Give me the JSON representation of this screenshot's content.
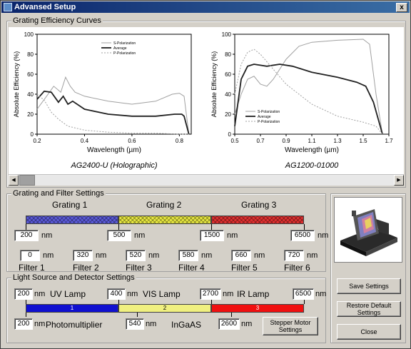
{
  "window": {
    "title": "Advansed Setup",
    "close_label": "x"
  },
  "curves": {
    "group_title": "Grating Efficiency Curves",
    "chart_data": [
      {
        "type": "line",
        "title": "",
        "caption": "AG2400-U  (Holographic)",
        "xlabel": "Wavelength (µm)",
        "ylabel": "Absolute Efficiency (%)",
        "xlim": [
          0.2,
          0.85
        ],
        "ylim": [
          0,
          100
        ],
        "xticks": [
          "0.2",
          "0.4",
          "0.6",
          "0.8"
        ],
        "yticks": [
          "0",
          "20",
          "40",
          "60",
          "80",
          "100"
        ],
        "legend": [
          "S-Polarization",
          "Average",
          "P-Polarization"
        ],
        "series": [
          {
            "name": "S-Polarization",
            "color": "#a0a0a0",
            "x": [
              0.2,
              0.24,
              0.27,
              0.3,
              0.32,
              0.34,
              0.36,
              0.4,
              0.5,
              0.6,
              0.7,
              0.77,
              0.8,
              0.82,
              0.84
            ],
            "y": [
              25,
              38,
              48,
              42,
              57,
              48,
              42,
              38,
              33,
              30,
              33,
              40,
              41,
              38,
              0
            ]
          },
          {
            "name": "Average",
            "color": "#202020",
            "x": [
              0.2,
              0.23,
              0.26,
              0.29,
              0.31,
              0.33,
              0.35,
              0.4,
              0.5,
              0.6,
              0.7,
              0.78,
              0.81,
              0.82,
              0.84
            ],
            "y": [
              35,
              43,
              42,
              32,
              38,
              30,
              33,
              25,
              20,
              18,
              18,
              20,
              20,
              18,
              0
            ]
          },
          {
            "name": "P-Polarization",
            "color": "#a0a0a0",
            "x": [
              0.2,
              0.23,
              0.26,
              0.29,
              0.33,
              0.4,
              0.5,
              0.6,
              0.7,
              0.8,
              0.84
            ],
            "y": [
              40,
              34,
              22,
              15,
              8,
              4,
              2,
              1,
              1,
              0,
              0
            ]
          }
        ]
      },
      {
        "type": "line",
        "title": "",
        "caption": "AG1200-01000",
        "xlabel": "Wavelength (µm)",
        "ylabel": "Absolute Efficiency (%)",
        "xlim": [
          0.5,
          1.7
        ],
        "ylim": [
          0,
          100
        ],
        "xticks": [
          "0.5",
          "0.7",
          "0.9",
          "1.1",
          "1.3",
          "1.5",
          "1.7"
        ],
        "yticks": [
          "0",
          "20",
          "40",
          "60",
          "80",
          "100"
        ],
        "legend": [
          "S-Polarization",
          "Average",
          "P-Polarization"
        ],
        "series": [
          {
            "name": "S-Polarization",
            "color": "#a0a0a0",
            "x": [
              0.5,
              0.55,
              0.6,
              0.65,
              0.7,
              0.75,
              0.8,
              0.9,
              1.0,
              1.1,
              1.3,
              1.5,
              1.55,
              1.6,
              1.65
            ],
            "y": [
              20,
              40,
              55,
              58,
              50,
              48,
              55,
              75,
              88,
              92,
              94,
              95,
              90,
              40,
              0
            ]
          },
          {
            "name": "Average",
            "color": "#202020",
            "x": [
              0.5,
              0.55,
              0.6,
              0.65,
              0.75,
              0.85,
              0.95,
              1.1,
              1.3,
              1.45,
              1.52,
              1.58,
              1.65
            ],
            "y": [
              8,
              55,
              68,
              70,
              68,
              70,
              68,
              62,
              57,
              52,
              48,
              32,
              0
            ]
          },
          {
            "name": "P-Polarization",
            "color": "#a0a0a0",
            "x": [
              0.5,
              0.55,
              0.6,
              0.65,
              0.7,
              0.8,
              0.9,
              1.1,
              1.3,
              1.5,
              1.6,
              1.65
            ],
            "y": [
              40,
              70,
              82,
              85,
              80,
              65,
              50,
              30,
              18,
              12,
              8,
              0
            ]
          }
        ]
      }
    ]
  },
  "grating_settings": {
    "group_title": "Grating and Filter Settings",
    "grating_labels": [
      "Grating 1",
      "Grating 2",
      "Grating 3"
    ],
    "boundary_values": [
      "200",
      "500",
      "1500",
      "6500"
    ],
    "unit": "nm",
    "filters": [
      {
        "value": "0",
        "label": "Filter 1"
      },
      {
        "value": "320",
        "label": "Filter 2"
      },
      {
        "value": "520",
        "label": "Filter 3"
      },
      {
        "value": "580",
        "label": "Filter 4"
      },
      {
        "value": "660",
        "label": "Filter 5"
      },
      {
        "value": "720",
        "label": "Filter 6"
      }
    ],
    "colors": {
      "grating1": "#5a5ad8",
      "grating2": "#e8e840",
      "grating3": "#e03030"
    }
  },
  "light_settings": {
    "group_title": "Light Source and Detector Settings",
    "lamp_values": [
      "200",
      "400",
      "2700",
      "6500"
    ],
    "lamp_labels": [
      "UV Lamp",
      "VIS Lamp",
      "IR Lamp"
    ],
    "segment_labels": [
      "1",
      "2",
      "3"
    ],
    "detector_values": [
      "200",
      "540",
      "2600"
    ],
    "detector_labels": [
      "Photomultiplier",
      "InGaAS"
    ],
    "unit": "nm",
    "stepper_button": "Stepper Motor Settings",
    "colors": {
      "seg1": "#1010d0",
      "seg2": "#f0f080",
      "seg3": "#f01010"
    }
  },
  "buttons": {
    "save": "Save Settings",
    "restore": "Restore Default Settings",
    "close": "Close"
  }
}
